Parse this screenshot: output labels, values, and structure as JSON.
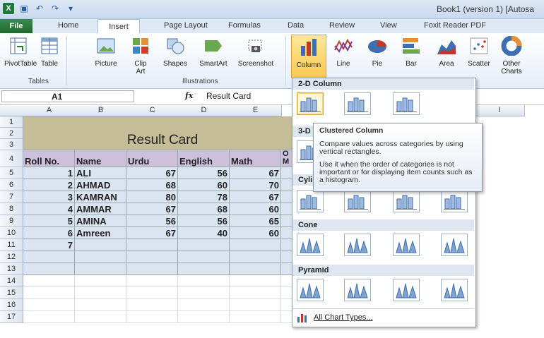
{
  "window": {
    "title": "Book1 (version 1) [Autosa"
  },
  "tabs": [
    "File",
    "Home",
    "Insert",
    "Page Layout",
    "Formulas",
    "Data",
    "Review",
    "View",
    "Foxit Reader PDF"
  ],
  "ribbon": {
    "buttons": [
      "PivotTable",
      "Table",
      "Picture",
      "Clip Art",
      "Shapes",
      "SmartArt",
      "Screenshot",
      "Column",
      "Line",
      "Pie",
      "Bar",
      "Area",
      "Scatter",
      "Other Charts"
    ],
    "groups": [
      "Tables",
      "Illustrations"
    ]
  },
  "formula_bar": {
    "name_box": "A1",
    "fx": "fx",
    "value": "Result Card"
  },
  "sheet": {
    "columns": [
      "A",
      "B",
      "C",
      "D",
      "E",
      "I"
    ],
    "rows": [
      "1",
      "2",
      "3",
      "4",
      "5",
      "6",
      "7",
      "8",
      "9",
      "10",
      "11",
      "12",
      "13",
      "14",
      "15",
      "16",
      "17"
    ],
    "title": "Result Card",
    "partial_header": "O",
    "partial_header2": "M",
    "headers": [
      "Roll No.",
      "Name",
      "Urdu",
      "English",
      "Math"
    ],
    "data": [
      [
        "1",
        "ALI",
        "67",
        "56",
        "67"
      ],
      [
        "2",
        "AHMAD",
        "68",
        "60",
        "70"
      ],
      [
        "3",
        "KAMRAN",
        "80",
        "78",
        "67"
      ],
      [
        "4",
        "AMMAR",
        "67",
        "68",
        "60"
      ],
      [
        "5",
        "AMINA",
        "56",
        "56",
        "65"
      ],
      [
        "6",
        "Amreen",
        "67",
        "40",
        "60"
      ],
      [
        "7",
        "",
        "",
        "",
        ""
      ]
    ]
  },
  "dropdown": {
    "sections": [
      "2-D Column",
      "3-D",
      "Cyli",
      "Cone",
      "Pyramid"
    ],
    "all_chart_types": "All Chart Types..."
  },
  "tooltip": {
    "title": "Clustered Column",
    "line1": "Compare values across categories by using vertical rectangles.",
    "line2": "Use it when the order of categories is not important or for displaying item counts such as a histogram."
  },
  "colors": {
    "title_fill": "#c4bd97",
    "header_fill": "#ccc0da",
    "data_fill": "#dbe5f1",
    "accent": "#f8c950"
  }
}
